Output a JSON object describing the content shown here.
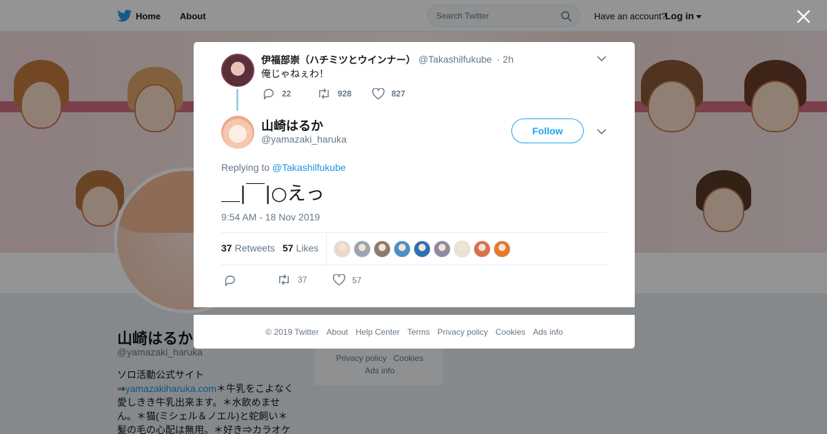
{
  "topbar": {
    "home": "Home",
    "about": "About",
    "search_placeholder": "Search Twitter",
    "have_account": "Have an account?",
    "login": "Log in"
  },
  "profile": {
    "name": "山崎はるか",
    "handle": "@yamazaki_haruka",
    "bio_line1": "ソロ活動公式サイト",
    "bio_arrow": "⇒",
    "bio_link": "yamazakiharuka.com",
    "bio_rest": "＊牛乳をこよなく愛しきき牛乳出来ます。＊水飲めません。＊猫(ミシェル＆ノエル)と蛇飼い＊髪の毛の心配は無用。＊好き⇒カラオケ"
  },
  "side_card": {
    "privacy": "Privacy policy",
    "cookies": "Cookies",
    "ads": "Ads info"
  },
  "parent_tweet": {
    "name": "伊福部崇（ハチミツとウインナー）",
    "handle": "@Takashilfukube",
    "time": "· 2h",
    "text": "俺じゃねぇわ！",
    "replies": "22",
    "retweets": "928",
    "likes": "827"
  },
  "main_tweet": {
    "name": "山崎はるか",
    "handle": "@yamazaki_haruka",
    "follow": "Follow",
    "replying_to_label": "Replying to",
    "replying_to_handle": "@Takashilfukube",
    "text": "＿|￣|○えっ",
    "timestamp": "9:54 AM - 18 Nov 2019",
    "retweet_count": "37",
    "retweet_label": "Retweets",
    "like_count": "57",
    "like_label": "Likes",
    "action_retweets": "37",
    "action_likes": "57"
  },
  "likers_colors": [
    "#e8d9c8",
    "#9aa5b1",
    "#8c7a6b",
    "#4a90c2",
    "#2d6fb5",
    "#8e8aa0",
    "#e9e2d0",
    "#d9704e",
    "#e37a2a"
  ],
  "footer": {
    "links": [
      "© 2019 Twitter",
      "About",
      "Help Center",
      "Terms",
      "Privacy policy",
      "Cookies",
      "Ads info"
    ]
  },
  "colors": {
    "accent": "#1da1f2",
    "link": "#1b95e0",
    "muted": "#657786",
    "text": "#14171a"
  }
}
